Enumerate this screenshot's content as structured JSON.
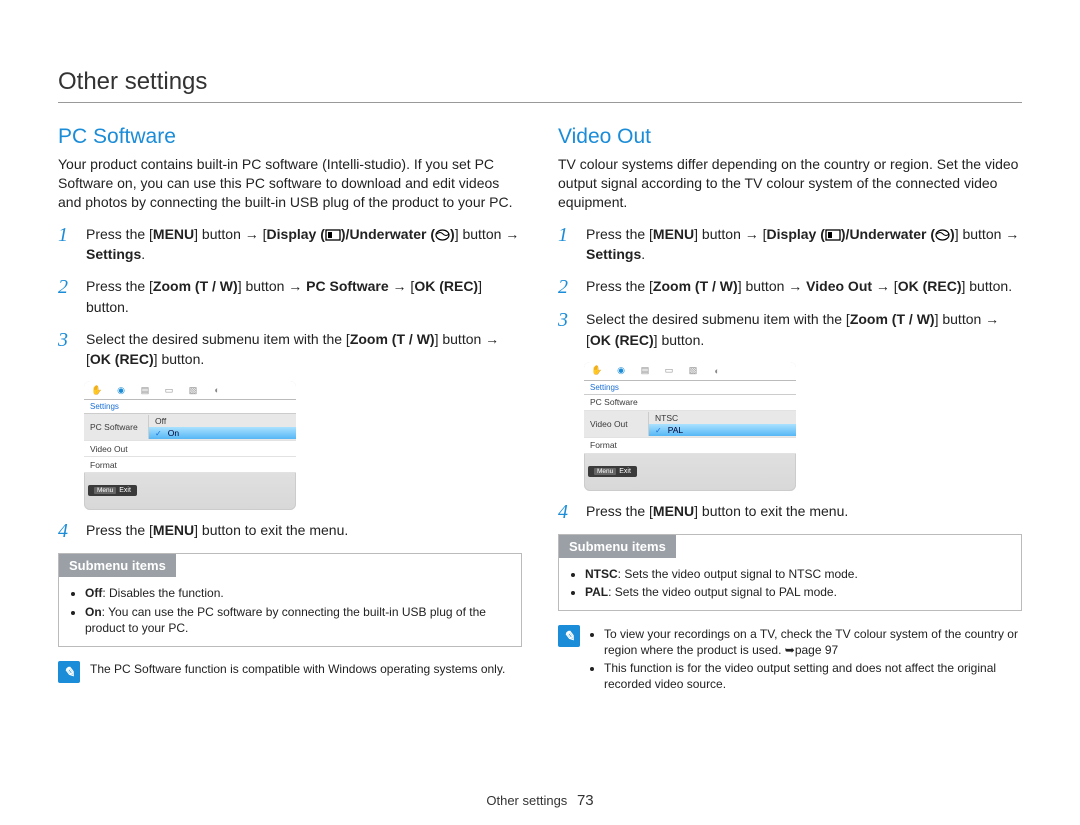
{
  "page_title": "Other settings",
  "footer": {
    "label": "Other settings",
    "page_number": "73"
  },
  "arrows": {
    "seq": "→",
    "cross": "➥"
  },
  "left": {
    "title": "PC Software",
    "intro": "Your product contains built-in PC software (Intelli-studio). If you set PC Software on, you can use this PC software to download and edit videos and photos by connecting the built-in USB plug of the product to your PC.",
    "steps": [
      {
        "num": "1",
        "parts": [
          "Press the [",
          "MENU",
          "] button → [",
          "Display (",
          ")/Underwater (",
          ")",
          "] button → ",
          "Settings",
          "."
        ]
      },
      {
        "num": "2",
        "parts": [
          "Press the [",
          "Zoom (T / W)",
          "] button → ",
          "PC Software",
          " → [",
          "OK (REC)",
          "] button."
        ]
      },
      {
        "num": "3",
        "parts": [
          "Select the desired submenu item with the [",
          "Zoom (T / W)",
          "] button → [",
          "OK (REC)",
          "] button."
        ]
      },
      {
        "num": "4",
        "parts": [
          "Press the [",
          "MENU",
          "] button to exit the menu."
        ]
      }
    ],
    "screenshot": {
      "breadcrumb": "Settings",
      "rows": [
        {
          "label": "PC Software",
          "options": [
            {
              "label": "Off",
              "sel": false
            },
            {
              "label": "On",
              "sel": true,
              "check": true
            }
          ],
          "highlighted": true
        },
        {
          "label": "Video Out"
        },
        {
          "label": "Format"
        }
      ],
      "footer_key": "Menu",
      "footer_label": "Exit"
    },
    "submenu": {
      "header": "Submenu items",
      "items": [
        {
          "term": "Off",
          "desc": ": Disables the function."
        },
        {
          "term": "On",
          "desc": ": You can use the PC software by connecting the built-in USB plug of the product to your PC."
        }
      ]
    },
    "note": "The PC Software function is compatible with Windows operating systems only."
  },
  "right": {
    "title": "Video Out",
    "intro": "TV colour systems differ depending on the country or region. Set the video output signal according to the TV colour system of the connected video equipment.",
    "steps": [
      {
        "num": "1",
        "parts": [
          "Press the [",
          "MENU",
          "] button → [",
          "Display (",
          ")/Underwater (",
          ")",
          "] button → ",
          "Settings",
          "."
        ]
      },
      {
        "num": "2",
        "parts": [
          "Press the [",
          "Zoom (T / W)",
          "] button → ",
          "Video Out",
          " → [",
          "OK (REC)",
          "] button."
        ]
      },
      {
        "num": "3",
        "parts": [
          "Select the desired submenu item with the [",
          "Zoom (T / W)",
          "] button → [",
          "OK (REC)",
          "] button."
        ]
      },
      {
        "num": "4",
        "parts": [
          "Press the [",
          "MENU",
          "] button to exit the menu."
        ]
      }
    ],
    "screenshot": {
      "breadcrumb": "Settings",
      "rows": [
        {
          "label": "PC Software"
        },
        {
          "label": "Video Out",
          "options": [
            {
              "label": "NTSC",
              "sel": false
            },
            {
              "label": "PAL",
              "sel": true,
              "check": true
            }
          ],
          "highlighted": true
        },
        {
          "label": "Format"
        }
      ],
      "footer_key": "Menu",
      "footer_label": "Exit"
    },
    "submenu": {
      "header": "Submenu items",
      "items": [
        {
          "term": "NTSC",
          "desc": ": Sets the video output signal to NTSC mode."
        },
        {
          "term": "PAL",
          "desc": ": Sets the video output signal to PAL mode."
        }
      ]
    },
    "notes": [
      "To view your recordings on a TV, check the TV colour system of the country or region where the product is used. ➥page 97",
      "This function is for the video output setting and does not affect the original recorded video source."
    ]
  }
}
